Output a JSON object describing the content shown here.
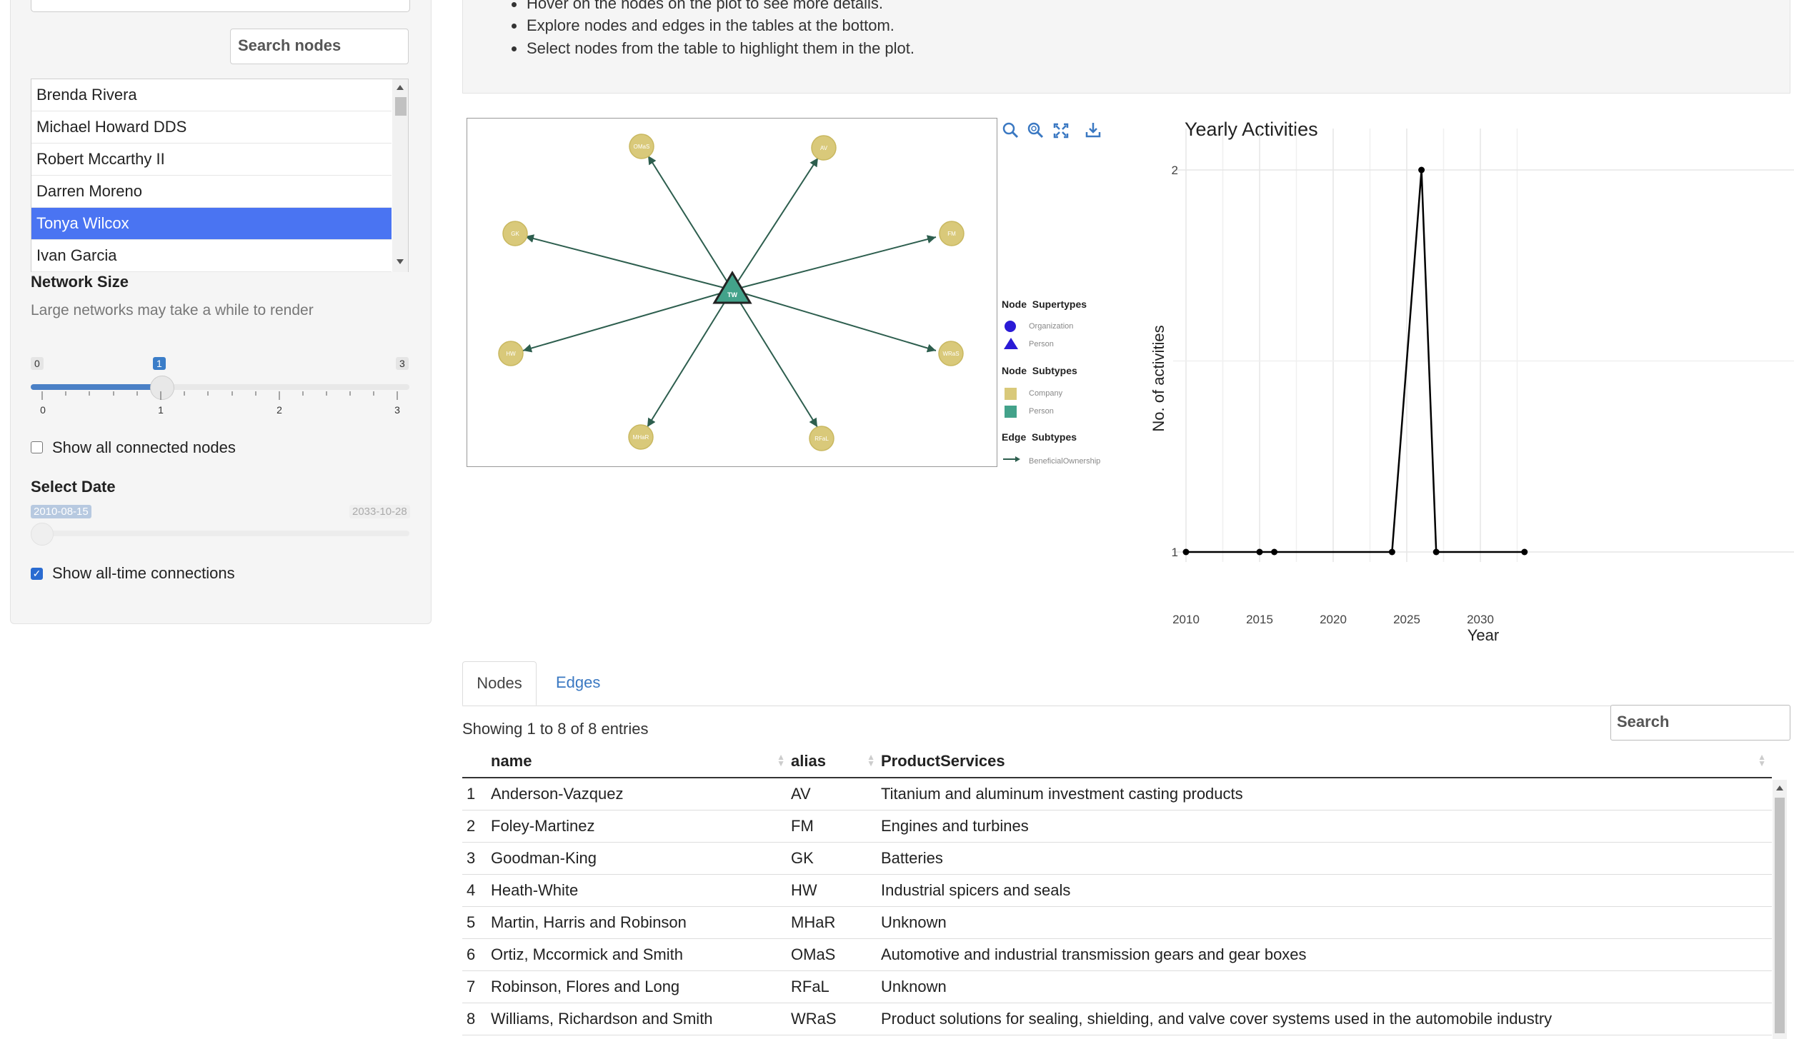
{
  "sidebar": {
    "search_placeholder": "Search nodes",
    "node_list": [
      "Brenda Rivera",
      "Michael Howard DDS",
      "Robert Mccarthy II",
      "Darren Moreno",
      "Tonya Wilcox",
      "Ivan Garcia"
    ],
    "selected_node": "Tonya Wilcox",
    "network_size": {
      "label": "Network Size",
      "help": "Large networks may take a while to render",
      "min": "0",
      "max": "3",
      "value": "1",
      "ticks": [
        "0",
        "1",
        "2",
        "3"
      ]
    },
    "show_connected_label": "Show all connected nodes",
    "show_connected_checked": false,
    "select_date": {
      "label": "Select Date",
      "start": "2010-08-15",
      "end": "2033-10-28"
    },
    "show_alltime_label": "Show all-time connections",
    "show_alltime_checked": true
  },
  "instructions": [
    "Hover on the nodes on the plot to see more details.",
    "Explore nodes and edges in the tables at the bottom.",
    "Select nodes from the table to highlight them in the plot."
  ],
  "network": {
    "center": "TW",
    "nodes": [
      "OMaS",
      "AV",
      "GK",
      "FM",
      "HW",
      "WRaS",
      "MHaR",
      "RFaL"
    ],
    "legend": {
      "supertypes_title": [
        "Node",
        "Supertypes"
      ],
      "supertypes": [
        "Organization",
        "Person"
      ],
      "subtypes_title": [
        "Node",
        "Subtypes"
      ],
      "subtypes": [
        "Company",
        "Person"
      ],
      "edge_title": [
        "Edge",
        "Subtypes"
      ],
      "edge_types": [
        "BeneficialOwnership"
      ]
    },
    "colors": {
      "company": "#d9c97a",
      "person": "#43a28a",
      "edge": "#2d5e4e",
      "organization": "#2a1ad6"
    },
    "toolbar_icons": [
      "zoom-icon",
      "zoom-in-icon",
      "fullscreen-icon",
      "download-icon"
    ]
  },
  "chart_data": {
    "type": "line",
    "title": "Yearly Activities",
    "xlabel": "Year",
    "ylabel": "No. of activities",
    "x": [
      2010,
      2015,
      2016,
      2024,
      2026,
      2027,
      2033
    ],
    "values": [
      1,
      1,
      1,
      1,
      2,
      1,
      1
    ],
    "xlim": [
      2010,
      2033
    ],
    "ylim": [
      1,
      2
    ],
    "xticks": [
      "2010",
      "2015",
      "2020",
      "2025",
      "2030"
    ],
    "yticks": [
      "1",
      "2"
    ],
    "grid": true
  },
  "tabs": [
    "Nodes",
    "Edges"
  ],
  "table": {
    "info": "Showing 1 to 8 of 8 entries",
    "search_placeholder": "Search",
    "columns": [
      "name",
      "alias",
      "ProductServices"
    ],
    "rows": [
      [
        "1",
        "Anderson-Vazquez",
        "AV",
        "Titanium and aluminum investment casting products"
      ],
      [
        "2",
        "Foley-Martinez",
        "FM",
        "Engines and turbines"
      ],
      [
        "3",
        "Goodman-King",
        "GK",
        "Batteries"
      ],
      [
        "4",
        "Heath-White",
        "HW",
        "Industrial spicers and seals"
      ],
      [
        "5",
        "Martin, Harris and Robinson",
        "MHaR",
        "Unknown"
      ],
      [
        "6",
        "Ortiz, Mccormick and Smith",
        "OMaS",
        "Automotive and industrial transmission gears and gear boxes"
      ],
      [
        "7",
        "Robinson, Flores and Long",
        "RFaL",
        "Unknown"
      ],
      [
        "8",
        "Williams, Richardson and Smith",
        "WRaS",
        "Product solutions for sealing, shielding, and valve cover systems used in the automobile industry"
      ]
    ]
  }
}
